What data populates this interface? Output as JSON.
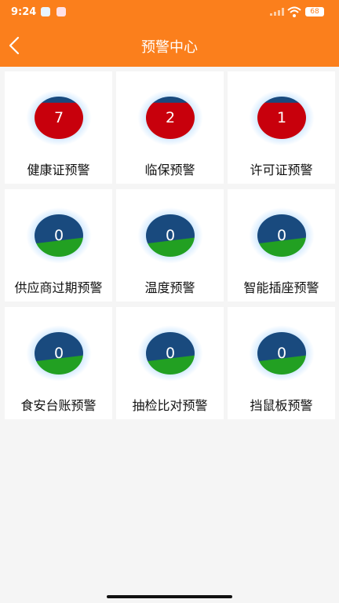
{
  "status_bar": {
    "time": "9:24",
    "battery": "68",
    "icons": [
      "telegram-icon",
      "notification-icon",
      "signal-icon",
      "wifi-icon",
      "battery-icon"
    ]
  },
  "header": {
    "title": "预警中心",
    "back_icon": "chevron-left-icon",
    "color": "#fb7f1c"
  },
  "cards": [
    {
      "label": "健康证预警",
      "count": "7",
      "status": "alert"
    },
    {
      "label": "临保预警",
      "count": "2",
      "status": "alert"
    },
    {
      "label": "许可证预警",
      "count": "1",
      "status": "alert"
    },
    {
      "label": "供应商过期预警",
      "count": "0",
      "status": "ok"
    },
    {
      "label": "温度预警",
      "count": "0",
      "status": "ok"
    },
    {
      "label": "智能插座预警",
      "count": "0",
      "status": "ok"
    },
    {
      "label": "食安台账预警",
      "count": "0",
      "status": "ok"
    },
    {
      "label": "抽检比对预警",
      "count": "0",
      "status": "ok"
    },
    {
      "label": "挡鼠板预警",
      "count": "0",
      "status": "ok"
    }
  ],
  "colors": {
    "alert": "#c8000c",
    "ok": "#22a022",
    "gauge_top": "#194a7e"
  }
}
